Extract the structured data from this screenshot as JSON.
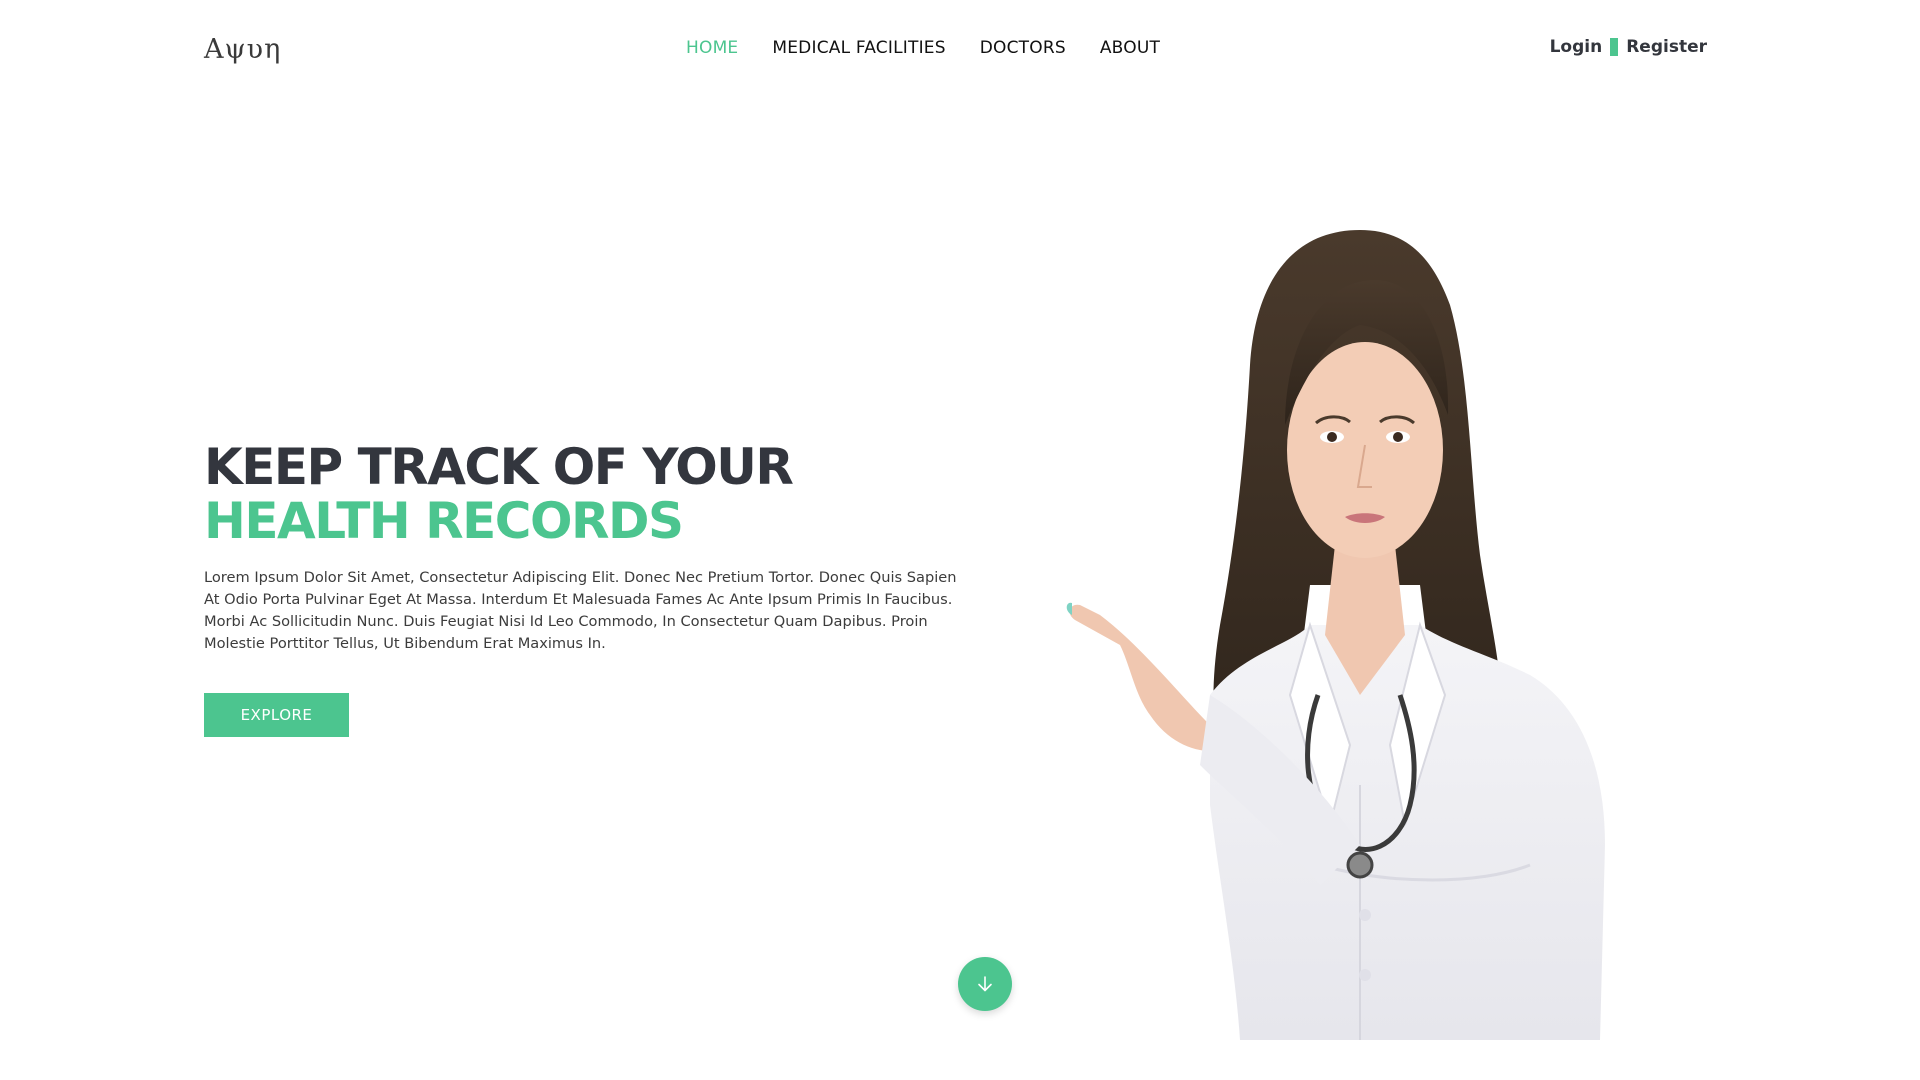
{
  "header": {
    "logo": "Aψυη",
    "nav": [
      {
        "label": "HOME",
        "active": true
      },
      {
        "label": "MEDICAL FACILITIES",
        "active": false
      },
      {
        "label": "DOCTORS",
        "active": false
      },
      {
        "label": "ABOUT",
        "active": false
      }
    ],
    "login_label": "Login",
    "register_label": "Register"
  },
  "hero": {
    "title_line1": "KEEP TRACK OF YOUR",
    "title_line2": "HEALTH RECORDS",
    "description": "Lorem Ipsum Dolor Sit Amet, Consectetur Adipiscing Elit. Donec Nec Pretium Tortor. Donec Quis Sapien At Odio Porta Pulvinar Eget At Massa. Interdum Et Malesuada Fames Ac Ante Ipsum Primis In Faucibus. Morbi Ac Sollicitudin Nunc. Duis Feugiat Nisi Id Leo Commodo, In Consectetur Quam Dapibus. Proin Molestie Porttitor Tellus, Ut Bibendum Erat Maximus In.",
    "explore_label": "EXPLORE",
    "scroll_icon": "arrow-down-icon"
  },
  "colors": {
    "accent": "#4cc58f",
    "heading_dark": "#33363e",
    "background": "#ffffff"
  }
}
